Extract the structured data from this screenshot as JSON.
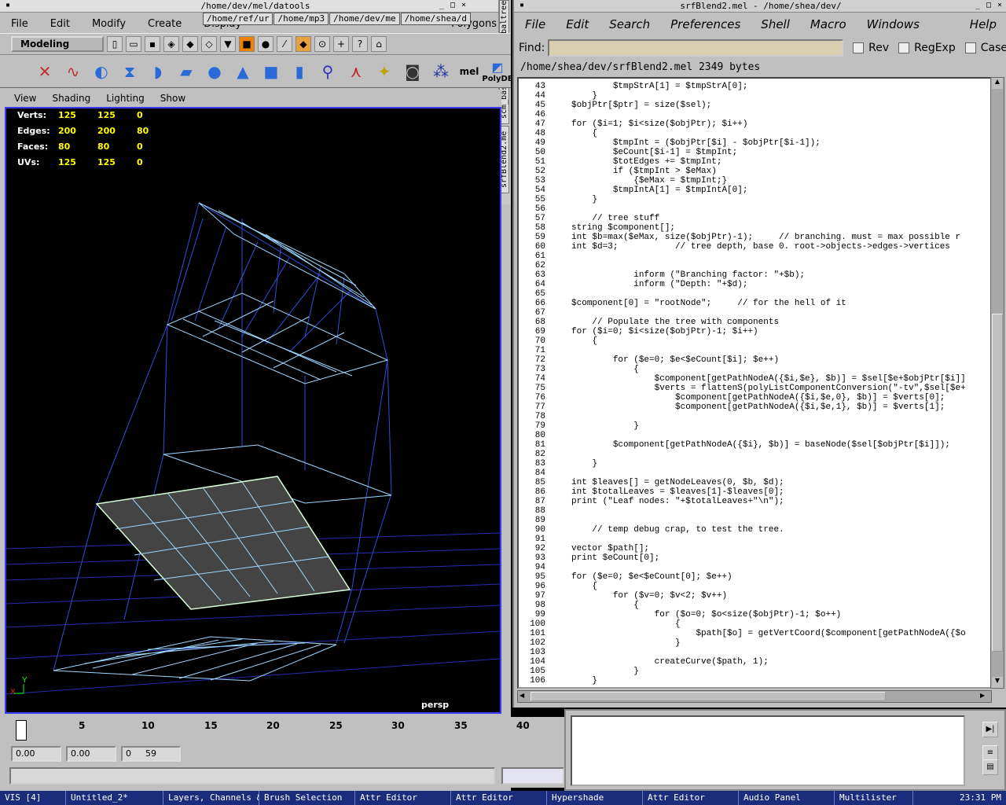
{
  "maya": {
    "menu": [
      "File",
      "Edit",
      "Modify",
      "Create",
      "Display",
      "Window"
    ],
    "menu_extra": "Polygons",
    "path_tabs": [
      "/home/ref/ur",
      "/home/mp3",
      "/home/dev/me",
      "/home/shea/d"
    ],
    "left_title": "/home/dev/mel/datools",
    "vtabs": [
      "scm_baltree",
      "scm_base.mel",
      "srfBlend2.me"
    ],
    "mode": "Modeling",
    "viewport_menu": [
      "View",
      "Shading",
      "Lighting",
      "Show"
    ],
    "hud": [
      {
        "label": "Verts:",
        "v": [
          "125",
          "125",
          "0"
        ]
      },
      {
        "label": "Edges:",
        "v": [
          "200",
          "200",
          "80"
        ]
      },
      {
        "label": "Faces:",
        "v": [
          "80",
          "80",
          "0"
        ]
      },
      {
        "label": "UVs:",
        "v": [
          "125",
          "125",
          "0"
        ]
      }
    ],
    "camera": "persp",
    "shelf_label": "PolyDE",
    "timeline_ticks": [
      "5",
      "10",
      "15",
      "20",
      "25",
      "30",
      "35",
      "40"
    ],
    "range": {
      "start": "0.00",
      "end": "0.00",
      "min": "0",
      "max": "59"
    }
  },
  "editor": {
    "title": "srfBlend2.mel - /home/shea/dev/",
    "menu": [
      "File",
      "Edit",
      "Search",
      "Preferences",
      "Shell",
      "Macro",
      "Windows",
      "Help"
    ],
    "find_label": "Find:",
    "checks": [
      "Rev",
      "RegExp",
      "Case"
    ],
    "fileinfo": "/home/shea/dev/srfBlend2.mel 2349 bytes",
    "lines": [
      {
        "n": "43",
        "t": "            $tmpStrA[1] = $tmpStrA[0];"
      },
      {
        "n": "44",
        "t": "        }"
      },
      {
        "n": "45",
        "t": "    $objPtr[$ptr] = size($sel);"
      },
      {
        "n": "46",
        "t": ""
      },
      {
        "n": "47",
        "t": "    for ($i=1; $i<size($objPtr); $i++)"
      },
      {
        "n": "48",
        "t": "        {"
      },
      {
        "n": "49",
        "t": "            $tmpInt = ($objPtr[$i] - $objPtr[$i-1]);"
      },
      {
        "n": "50",
        "t": "            $eCount[$i-1] = $tmpInt;"
      },
      {
        "n": "51",
        "t": "            $totEdges += $tmpInt;"
      },
      {
        "n": "52",
        "t": "            if ($tmpInt > $eMax)"
      },
      {
        "n": "53",
        "t": "                {$eMax = $tmpInt;}"
      },
      {
        "n": "54",
        "t": "            $tmpIntA[1] = $tmpIntA[0];"
      },
      {
        "n": "55",
        "t": "        }"
      },
      {
        "n": "56",
        "t": ""
      },
      {
        "n": "57",
        "t": "        // tree stuff"
      },
      {
        "n": "58",
        "t": "    string $component[];"
      },
      {
        "n": "59",
        "t": "    int $b=max($eMax, size($objPtr)-1);     // branching. must = max possible r"
      },
      {
        "n": "60",
        "t": "    int $d=3;           // tree depth, base 0. root->objects->edges->vertices"
      },
      {
        "n": "61",
        "t": ""
      },
      {
        "n": "62",
        "t": ""
      },
      {
        "n": "63",
        "t": "                inform (\"Branching factor: \"+$b);"
      },
      {
        "n": "64",
        "t": "                inform (\"Depth: \"+$d);"
      },
      {
        "n": "65",
        "t": ""
      },
      {
        "n": "66",
        "t": "    $component[0] = \"rootNode\";     // for the hell of it"
      },
      {
        "n": "67",
        "t": ""
      },
      {
        "n": "68",
        "t": "        // Populate the tree with components"
      },
      {
        "n": "69",
        "t": "    for ($i=0; $i<size($objPtr)-1; $i++)"
      },
      {
        "n": "70",
        "t": "        {"
      },
      {
        "n": "71",
        "t": ""
      },
      {
        "n": "72",
        "t": "            for ($e=0; $e<$eCount[$i]; $e++)"
      },
      {
        "n": "73",
        "t": "                {"
      },
      {
        "n": "74",
        "t": "                    $component[getPathNodeA({$i,$e}, $b)] = $sel[$e+$objPtr[$i]]"
      },
      {
        "n": "75",
        "t": "                    $verts = flattenS(polyListComponentConversion(\"-tv\",$sel[$e+"
      },
      {
        "n": "76",
        "t": "                        $component[getPathNodeA({$i,$e,0}, $b)] = $verts[0];"
      },
      {
        "n": "77",
        "t": "                        $component[getPathNodeA({$i,$e,1}, $b)] = $verts[1];"
      },
      {
        "n": "78",
        "t": ""
      },
      {
        "n": "79",
        "t": "                }"
      },
      {
        "n": "80",
        "t": ""
      },
      {
        "n": "81",
        "t": "            $component[getPathNodeA({$i}, $b)] = baseNode($sel[$objPtr[$i]]);"
      },
      {
        "n": "82",
        "t": ""
      },
      {
        "n": "83",
        "t": "        }"
      },
      {
        "n": "84",
        "t": ""
      },
      {
        "n": "85",
        "t": "    int $leaves[] = getNodeLeaves(0, $b, $d);"
      },
      {
        "n": "86",
        "t": "    int $totalLeaves = $leaves[1]-$leaves[0];"
      },
      {
        "n": "87",
        "t": "    print (\"Leaf nodes: \"+$totalLeaves+\"\\n\");"
      },
      {
        "n": "88",
        "t": ""
      },
      {
        "n": "89",
        "t": ""
      },
      {
        "n": "90",
        "t": "        // temp debug crap, to test the tree."
      },
      {
        "n": "91",
        "t": ""
      },
      {
        "n": "92",
        "t": "    vector $path[];"
      },
      {
        "n": "93",
        "t": "    print $eCount[0];"
      },
      {
        "n": "94",
        "t": ""
      },
      {
        "n": "95",
        "t": "    for ($e=0; $e<$eCount[0]; $e++)"
      },
      {
        "n": "96",
        "t": "        {"
      },
      {
        "n": "97",
        "t": "            for ($v=0; $v<2; $v++)"
      },
      {
        "n": "98",
        "t": "                {"
      },
      {
        "n": "99",
        "t": "                    for ($o=0; $o<size($objPtr)-1; $o++)"
      },
      {
        "n": "100",
        "t": "                        {"
      },
      {
        "n": "101",
        "t": "                            $path[$o] = getVertCoord($component[getPathNodeA({$o"
      },
      {
        "n": "102",
        "t": "                        }"
      },
      {
        "n": "103",
        "t": ""
      },
      {
        "n": "104",
        "t": "                    createCurve($path, 1);"
      },
      {
        "n": "105",
        "t": "                }"
      },
      {
        "n": "106",
        "t": "        }"
      }
    ]
  },
  "taskbar": [
    "VIS [4]",
    "Untitled_2*",
    "Layers, Channels &",
    "Brush Selection",
    "Attr Editor",
    "Attr Editor",
    "Hypershade",
    "Attr Editor",
    "Audio Panel",
    "Multilister"
  ],
  "clock": "23:31 PM"
}
